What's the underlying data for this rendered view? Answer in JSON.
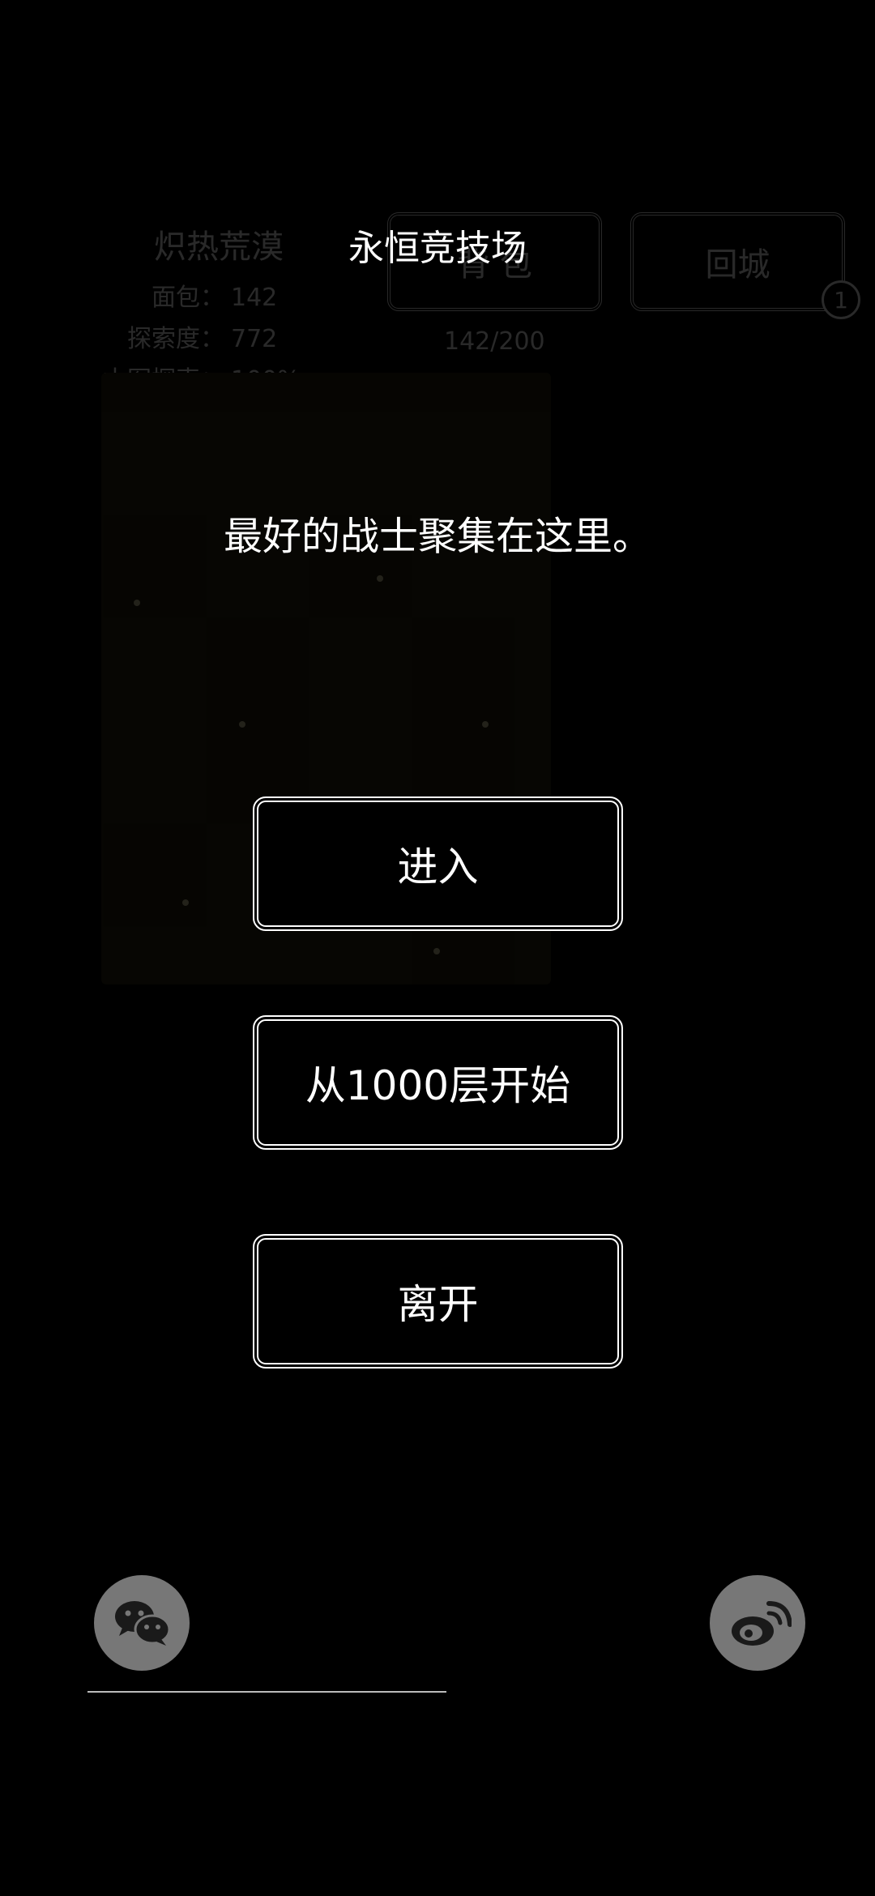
{
  "background": {
    "location": "炽热荒漠",
    "stats": [
      {
        "label": "面包：",
        "value": "142"
      },
      {
        "label": "探索度：",
        "value": "772"
      },
      {
        "label": "本图探索：",
        "value": "100%"
      }
    ],
    "bag_button_label": "背 包",
    "town_button_label": "回城",
    "town_badge": "1",
    "capacity": "142/200"
  },
  "dialog": {
    "title": "永恒竞技场",
    "message": "最好的战士聚集在这里。",
    "buttons": {
      "enter": "进入",
      "start_from_1000": "从1000层开始",
      "leave": "离开"
    }
  },
  "share": {
    "wechat_icon": "wechat-icon",
    "weibo_icon": "weibo-icon"
  }
}
